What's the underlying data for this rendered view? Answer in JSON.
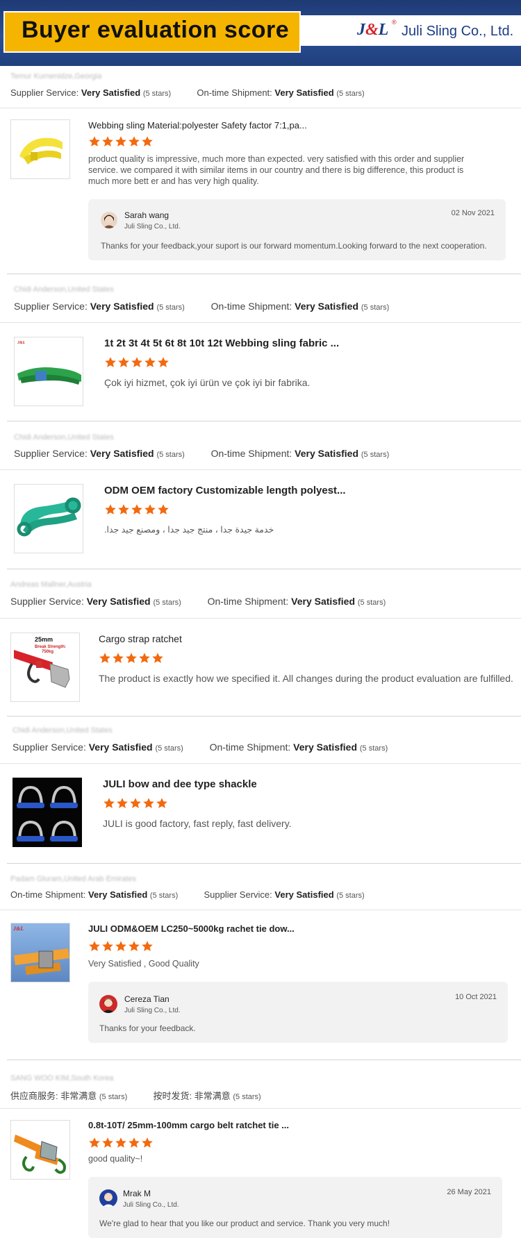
{
  "header": {
    "title": "Buyer evaluation score",
    "logo_text": "J&L",
    "company": "Juli Sling Co., Ltd."
  },
  "colors": {
    "accent": "#f5b400",
    "star": "#f26a0f",
    "navy": "#1e3a74"
  },
  "reviews": [
    {
      "buyer": "Temur Kurnenidze,Georgia",
      "first_label": "Supplier Service:",
      "first_value": "Very Satisfied",
      "first_stars": "(5 stars)",
      "second_label": "On-time Shipment:",
      "second_value": "Very Satisfied",
      "second_stars": "(5 stars)",
      "product_title": "Webbing sling Material:polyester Safety factor 7:1,pa...",
      "rating": 5,
      "comment": "product quality is impressive, much more than expected. very satisfied with this order and supplier service. we compared it with similar items in our country and there is big difference, this product is much more bett er and has very high quality.",
      "reply": {
        "name": "Sarah wang",
        "company": "Juli Sling Co., Ltd.",
        "date": "02 Nov 2021",
        "text": "Thanks for your feedback,your suport is our forward momentum.Looking forward to the next cooperation."
      }
    },
    {
      "buyer": "Chidi Anderson,United States",
      "first_label": "Supplier Service:",
      "first_value": "Very Satisfied",
      "first_stars": "(5 stars)",
      "second_label": "On-time Shipment:",
      "second_value": "Very Satisfied",
      "second_stars": "(5 stars)",
      "product_title": "1t 2t 3t 4t 5t 6t 8t 10t 12t Webbing sling fabric ...",
      "rating": 5,
      "comment": "Çok iyi hizmet, çok iyi ürün ve çok iyi bir fabrika."
    },
    {
      "buyer": "Chidi Anderson,United States",
      "first_label": "Supplier Service:",
      "first_value": "Very Satisfied",
      "first_stars": "(5 stars)",
      "second_label": "On-time Shipment:",
      "second_value": "Very Satisfied",
      "second_stars": "(5 stars)",
      "product_title": "ODM OEM factory Customizable length polyest...",
      "rating": 5,
      "comment": "خدمة جيدة جدا ، منتج جيد جدا ، ومصنع جيد جدا."
    },
    {
      "buyer": "Andreas Mallner,Austria",
      "first_label": "Supplier Service:",
      "first_value": "Very Satisfied",
      "first_stars": "(5 stars)",
      "second_label": "On-time Shipment:",
      "second_value": "Very Satisfied",
      "second_stars": "(5 stars)",
      "product_title": "Cargo strap ratchet",
      "rating": 5,
      "comment": "The product is exactly how we specified it. All changes during the product evaluation are fulfilled.",
      "thumb_caption_1": "25mm",
      "thumb_caption_2": "Break Strength:",
      "thumb_caption_3": "750kg"
    },
    {
      "buyer": "Chidi Anderson,United States",
      "first_label": "Supplier Service:",
      "first_value": "Very Satisfied",
      "first_stars": "(5 stars)",
      "second_label": "On-time Shipment:",
      "second_value": "Very Satisfied",
      "second_stars": "(5 stars)",
      "product_title": "JULI bow and dee type shackle",
      "rating": 5,
      "comment": "JULI is good factory, fast reply, fast delivery."
    },
    {
      "buyer": "Padam Gluram,United Arab Emirates",
      "first_label": "On-time Shipment:",
      "first_value": "Very Satisfied",
      "first_stars": "(5 stars)",
      "second_label": "Supplier Service:",
      "second_value": "Very Satisfied",
      "second_stars": "(5 stars)",
      "product_title": "JULI ODM&OEM LC250~5000kg rachet tie dow...",
      "rating": 5,
      "comment": "Very Satisfied , Good Quality",
      "reply": {
        "name": "Cereza Tian",
        "company": "Juli Sling Co., Ltd.",
        "date": "10 Oct 2021",
        "text": "Thanks for your feedback."
      }
    },
    {
      "buyer": "SANG WOO KIM,South Korea",
      "first_label": "供应商服务:",
      "first_value": "非常满意",
      "first_stars": "(5 stars)",
      "second_label": "按时发货:",
      "second_value": "非常满意",
      "second_stars": "(5 stars)",
      "product_title": "0.8t-10T/ 25mm-100mm cargo belt ratchet tie ...",
      "rating": 5,
      "comment": "good quality~!",
      "reply": {
        "name": "Mrak M",
        "company": "Juli Sling Co., Ltd.",
        "date": "26 May 2021",
        "text": "We're glad to hear that you like our product and service. Thank you very much!"
      }
    }
  ]
}
